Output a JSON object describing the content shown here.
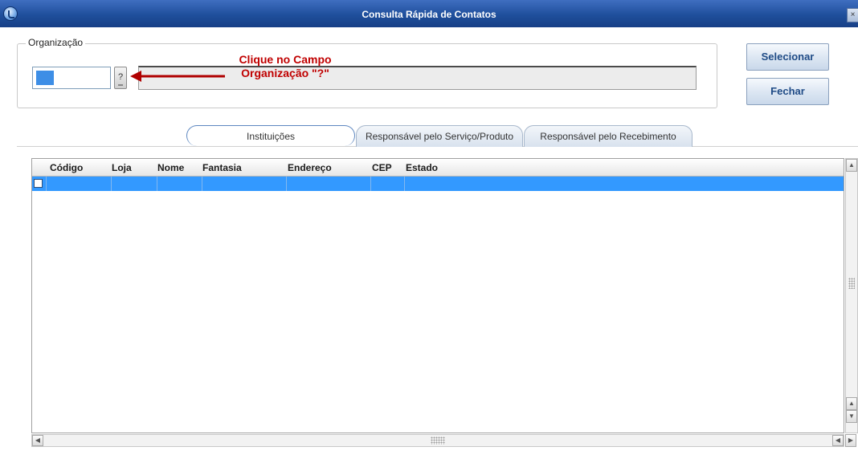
{
  "window": {
    "title": "Consulta Rápida de Contatos",
    "close_glyph": "×",
    "icon": "app-globe-icon"
  },
  "organizacao": {
    "group_label": "Organização",
    "lookup_label": "?",
    "code_value": "",
    "description_value": ""
  },
  "annotation": {
    "line1": "Clique no Campo",
    "line2": "Organização \"?\"",
    "color": "#c00000"
  },
  "buttons": {
    "selecionar": "Selecionar",
    "fechar": "Fechar"
  },
  "tabs": [
    {
      "label": "Instituições",
      "active": true
    },
    {
      "label": "Responsável pelo Serviço/Produto",
      "active": false
    },
    {
      "label": "Responsável pelo Recebimento",
      "active": false
    }
  ],
  "grid": {
    "columns": [
      "Código",
      "Loja",
      "Nome",
      "Fantasia",
      "Endereço",
      "CEP",
      "Estado"
    ],
    "selected_row_color": "#3399ff"
  },
  "scrollbar": {
    "up": "▲",
    "down": "▼",
    "left": "◀",
    "right": "▶"
  }
}
